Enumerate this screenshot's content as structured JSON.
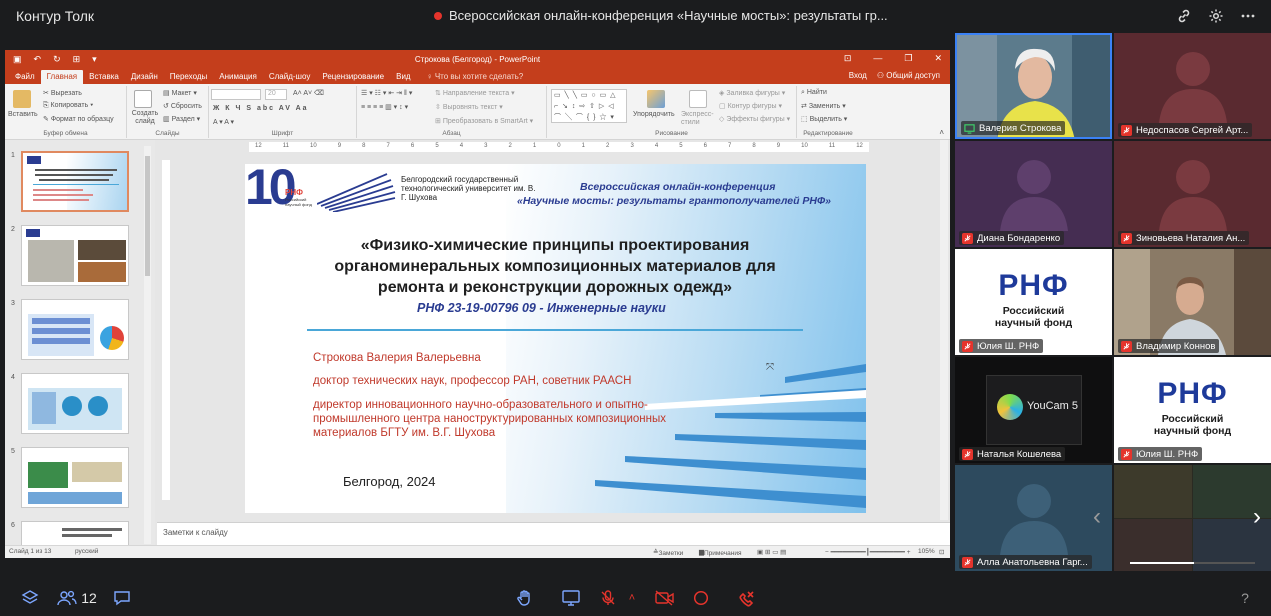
{
  "app": {
    "title": "Контур Толк"
  },
  "meeting": {
    "title": "Всероссийская онлайн-конференция «Научные мосты»: результаты гр...",
    "rec_color": "#e5342c"
  },
  "top_icons": [
    "link-icon",
    "gear-icon",
    "more-icon"
  ],
  "powerpoint": {
    "window_title": "Строкова (Белгород) - PowerPoint",
    "accent": "#c43e1c",
    "tabs": [
      "Файл",
      "Главная",
      "Вставка",
      "Дизайн",
      "Переходы",
      "Анимация",
      "Слайд-шоу",
      "Рецензирование",
      "Вид"
    ],
    "active_tab": "Главная",
    "tell_me": "♀ Что вы хотите сделать?",
    "signin": "Вход",
    "share": "⚇ Общий доступ",
    "ribbon": {
      "paste": "Вставить",
      "cut": "Вырезать",
      "copy": "Копировать",
      "format_painter": "Формат по образцу",
      "clipboard": "Буфер обмена",
      "new_slide": "Создать слайд",
      "layout": "Макет",
      "reset": "Сбросить",
      "section": "Раздел",
      "slides": "Слайды",
      "font_size": "20",
      "font": "Шрифт",
      "text_direction": "Направление текста",
      "align_text": "Выровнять текст",
      "smartart": "Преобразовать в SmartArt",
      "paragraph": "Абзац",
      "arrange": "Упорядочить",
      "quick_styles": "Экспресс-стили",
      "shape_fill": "Заливка фигуры",
      "shape_outline": "Контур фигуры",
      "shape_effects": "Эффекты фигуры",
      "drawing": "Рисование",
      "find": "Найти",
      "replace": "Заменить",
      "select": "Выделить",
      "editing": "Редактирование"
    },
    "thumbnails": [
      "1",
      "2",
      "3",
      "4",
      "5",
      "6"
    ],
    "selected_slide": "1",
    "ruler_marks": [
      "12",
      "11",
      "10",
      "9",
      "8",
      "7",
      "6",
      "5",
      "4",
      "3",
      "2",
      "1",
      "0",
      "1",
      "2",
      "3",
      "4",
      "5",
      "6",
      "7",
      "8",
      "9",
      "10",
      "11",
      "12"
    ],
    "slide": {
      "logo_num": "10",
      "logo_rnf": "РНФ",
      "logo_small": "Российский научный фонд",
      "university": "Белгородский государственный технологический университет им. В. Г. Шухова",
      "conf_line1": "Всероссийская онлайн-конференция",
      "conf_line2": "«Научные мосты: результаты грантополучателей РНФ»",
      "title": "«Физико-химические принципы проектирования органоминеральных композиционных материалов для ремонта и реконструкции дорожных одежд»",
      "grant": "РНФ 23-19-00796 09 - Инженерные науки",
      "author": "Строкова Валерия Валерьевна",
      "degree": "доктор технических наук, профессор РАН, советник РААСН",
      "position": "директор инновационного научно-образовательного и опытно-промышленного центра наноструктурированных композиционных материалов БГТУ им. В.Г. Шухова",
      "city": "Белгород, 2024"
    },
    "notes_placeholder": "Заметки к слайду",
    "status": {
      "slide_counter": "Слайд 1 из 13",
      "language": "русский",
      "notes": "Заметки",
      "comments": "Примечания",
      "zoom": "105%"
    }
  },
  "participants": [
    {
      "name": "Валерия Строкова",
      "muted": false,
      "active": true
    },
    {
      "name": "Недоспасов Сергей Арт...",
      "muted": true
    },
    {
      "name": "Диана Бондаренко",
      "muted": true
    },
    {
      "name": "Зиновьева Наталия Ан...",
      "muted": true
    },
    {
      "name": "Юлия Ш. РНФ",
      "muted": true,
      "logo": true
    },
    {
      "name": "Владимир Коннов",
      "muted": true
    },
    {
      "name": "Наталья Кошелева",
      "muted": true,
      "youcam": "YouCam 5"
    },
    {
      "name": "Юлия Ш. РНФ",
      "muted": true,
      "logo": true
    },
    {
      "name": "Алла Анатольевна Гарг...",
      "muted": true
    }
  ],
  "rnf_logo": {
    "letters": "РНФ",
    "subtitle": "Российский научный фонд"
  },
  "participant_count": "12",
  "bottom_controls": [
    "layers-icon",
    "participants-icon",
    "chat-icon",
    "raise-hand-icon",
    "screen-share-icon",
    "mic-muted-icon",
    "chevron-up-icon",
    "camera-off-icon",
    "record-icon",
    "leave-call-icon",
    "help-icon"
  ],
  "help": "?"
}
